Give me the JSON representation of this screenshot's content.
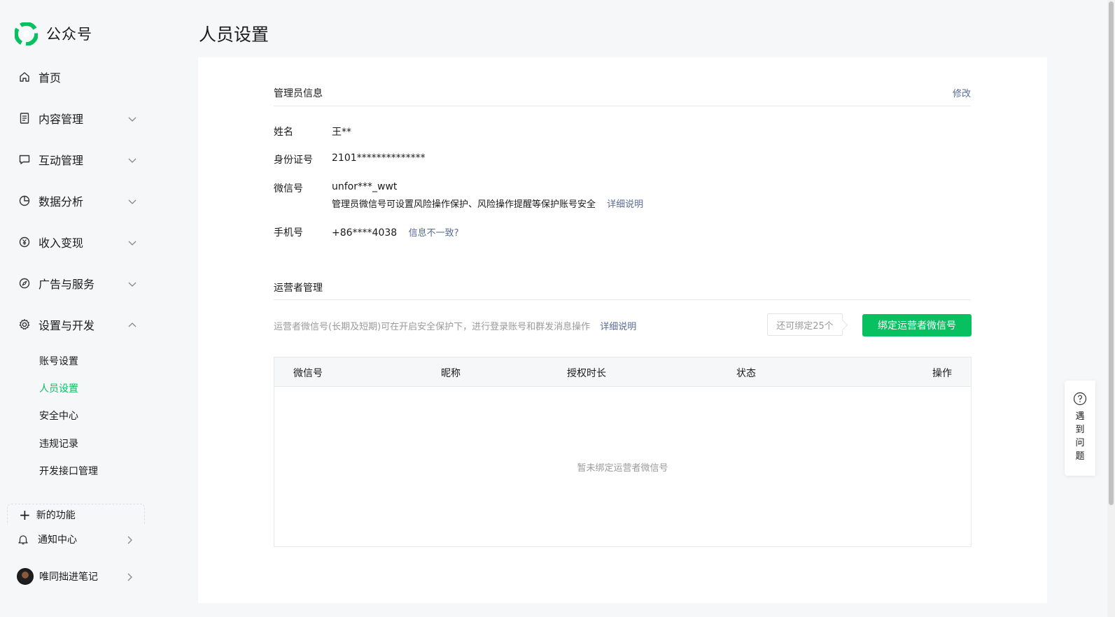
{
  "app": {
    "name": "公众号"
  },
  "sidebar": {
    "nav": [
      {
        "label": "首页",
        "icon": "home-icon",
        "expandable": false
      },
      {
        "label": "内容管理",
        "icon": "document-icon",
        "expandable": true
      },
      {
        "label": "互动管理",
        "icon": "chat-icon",
        "expandable": true
      },
      {
        "label": "数据分析",
        "icon": "pie-chart-icon",
        "expandable": true
      },
      {
        "label": "收入变现",
        "icon": "yen-icon",
        "expandable": true
      },
      {
        "label": "广告与服务",
        "icon": "compass-icon",
        "expandable": true
      },
      {
        "label": "设置与开发",
        "icon": "gear-icon",
        "expandable": true,
        "expanded": true
      }
    ],
    "subitems": [
      {
        "label": "账号设置",
        "active": false
      },
      {
        "label": "人员设置",
        "active": true
      },
      {
        "label": "安全中心",
        "active": false
      },
      {
        "label": "违规记录",
        "active": false
      },
      {
        "label": "开发接口管理",
        "active": false
      }
    ],
    "new_feature": "新的功能",
    "notify": "通知中心",
    "account_name": "唯同拙进笔记"
  },
  "page": {
    "title": "人员设置"
  },
  "admin": {
    "heading": "管理员信息",
    "edit_link": "修改",
    "name_label": "姓名",
    "name_value": "王**",
    "id_label": "身份证号",
    "id_value": "2101**************",
    "wechat_label": "微信号",
    "wechat_value": "unfor***_wwt",
    "wechat_hint": "管理员微信号可设置风险操作保护、风险操作提醒等保护账号安全",
    "wechat_hint_link": "详细说明",
    "phone_label": "手机号",
    "phone_value": "+86****4038",
    "phone_link": "信息不一致?"
  },
  "operators": {
    "heading": "运营者管理",
    "description": "运营者微信号(长期及短期)可在开启安全保护下，进行登录账号和群发消息操作",
    "description_link": "详细说明",
    "quota": "还可绑定25个",
    "bind_button": "绑定运营者微信号",
    "columns": [
      "微信号",
      "昵称",
      "授权时长",
      "状态",
      "操作"
    ],
    "rows": [],
    "empty_text": "暂未绑定运营者微信号"
  },
  "help": {
    "label": "遇到问题"
  },
  "colors": {
    "accent": "#07c160",
    "link": "#576b95",
    "muted": "#9a9a9a"
  }
}
